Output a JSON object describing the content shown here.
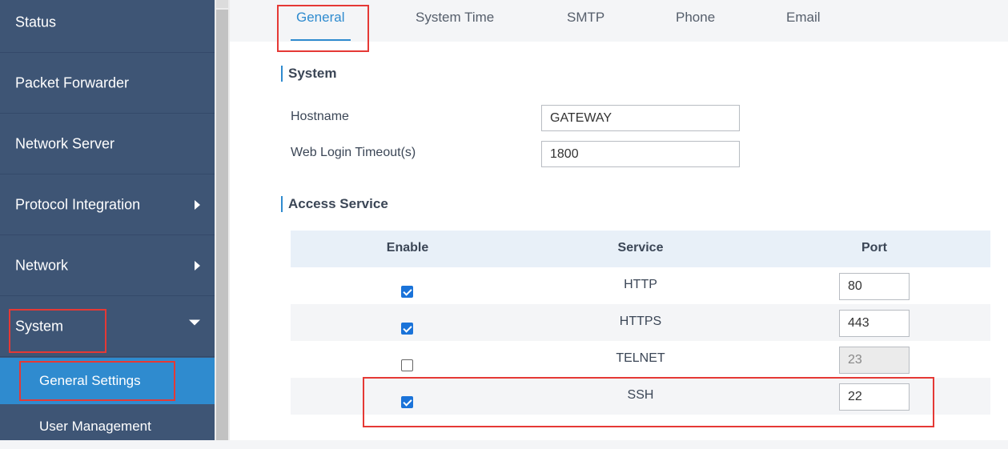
{
  "sidebar": {
    "items": [
      {
        "label": "Status"
      },
      {
        "label": "Packet Forwarder"
      },
      {
        "label": "Network Server"
      },
      {
        "label": "Protocol Integration"
      },
      {
        "label": "Network"
      },
      {
        "label": "System"
      }
    ],
    "subitems": [
      {
        "label": "General Settings",
        "active": true
      },
      {
        "label": "User Management"
      }
    ]
  },
  "tabs": [
    {
      "label": "General",
      "active": true
    },
    {
      "label": "System Time"
    },
    {
      "label": "SMTP"
    },
    {
      "label": "Phone"
    },
    {
      "label": "Email"
    }
  ],
  "system": {
    "title": "System",
    "hostname_label": "Hostname",
    "hostname_value": "GATEWAY",
    "timeout_label": "Web Login Timeout(s)",
    "timeout_value": "1800"
  },
  "access": {
    "title": "Access Service",
    "columns": [
      "Enable",
      "Service",
      "Port"
    ],
    "rows": [
      {
        "enabled": true,
        "service": "HTTP",
        "port": "80",
        "port_disabled": false
      },
      {
        "enabled": true,
        "service": "HTTPS",
        "port": "443",
        "port_disabled": false
      },
      {
        "enabled": false,
        "service": "TELNET",
        "port": "23",
        "port_disabled": true
      },
      {
        "enabled": true,
        "service": "SSH",
        "port": "22",
        "port_disabled": false
      }
    ]
  },
  "colors": {
    "sidebar_bg": "#3e5575",
    "accent": "#2f8bcf",
    "highlight": "#e53935"
  }
}
